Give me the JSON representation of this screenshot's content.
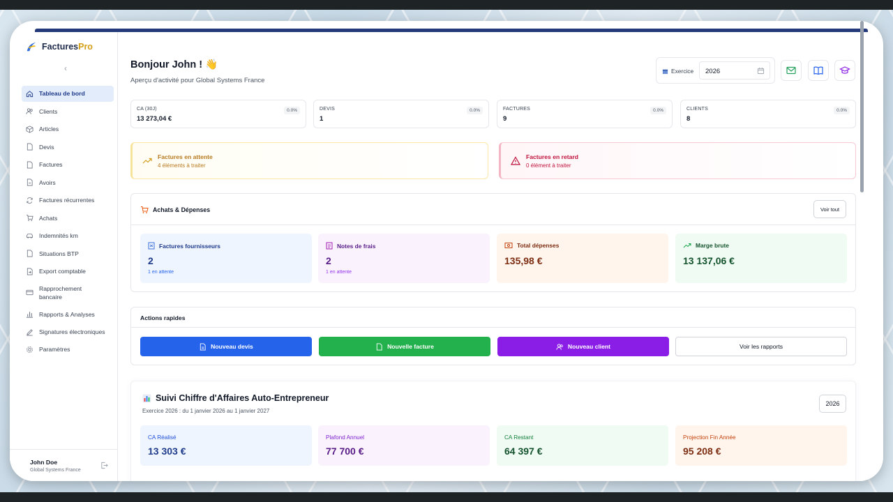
{
  "app": {
    "brand_main": "Factures",
    "brand_accent": "Pro"
  },
  "sidebar": {
    "collapse_icon": "chevron-left-icon",
    "items": [
      {
        "label": "Tableau de bord",
        "icon": "home-icon"
      },
      {
        "label": "Clients",
        "icon": "users-icon"
      },
      {
        "label": "Articles",
        "icon": "box-icon"
      },
      {
        "label": "Devis",
        "icon": "file-icon"
      },
      {
        "label": "Factures",
        "icon": "file-icon"
      },
      {
        "label": "Avoirs",
        "icon": "file-minus-icon"
      },
      {
        "label": "Factures récurrentes",
        "icon": "refresh-icon"
      },
      {
        "label": "Achats",
        "icon": "cart-icon"
      },
      {
        "label": "Indemnités km",
        "icon": "car-icon"
      },
      {
        "label": "Situations BTP",
        "icon": "file-icon"
      },
      {
        "label": "Export comptable",
        "icon": "export-icon"
      },
      {
        "label": "Rapprochement bancaire",
        "icon": "card-icon"
      },
      {
        "label": "Rapports & Analyses",
        "icon": "bar-chart-icon"
      },
      {
        "label": "Signatures électroniques",
        "icon": "pen-icon"
      },
      {
        "label": "Paramètres",
        "icon": "gear-icon"
      }
    ],
    "user": {
      "name": "John Doe",
      "org": "Global Systems France"
    }
  },
  "header": {
    "greeting": "Bonjour John ! 👋",
    "subtitle": "Aperçu d'activité pour Global Systems France",
    "exercise_label": "Exercice",
    "exercise_value": "2026"
  },
  "stats": [
    {
      "label": "CA (30J)",
      "value": "13 273,04 €",
      "badge": "0.0%"
    },
    {
      "label": "DEVIS",
      "value": "1",
      "badge": "0.0%"
    },
    {
      "label": "FACTURES",
      "value": "9",
      "badge": "0.0%"
    },
    {
      "label": "CLIENTS",
      "value": "8",
      "badge": "0.0%"
    }
  ],
  "alerts": {
    "pending": {
      "title": "Factures en attente",
      "sub": "4 éléments à traiter"
    },
    "late": {
      "title": "Factures en retard",
      "sub": "0 élément à traiter"
    }
  },
  "achats": {
    "title": "Achats & Dépenses",
    "see_all": "Voir tout",
    "metrics": [
      {
        "label": "Factures fournisseurs",
        "value": "2",
        "sub": "1 en attente"
      },
      {
        "label": "Notes de frais",
        "value": "2",
        "sub": "1 en attente"
      },
      {
        "label": "Total dépenses",
        "value": "135,98 €",
        "sub": ""
      },
      {
        "label": "Marge brute",
        "value": "13 137,06 €",
        "sub": ""
      }
    ]
  },
  "actions": {
    "title": "Actions rapides",
    "buttons": [
      {
        "label": "Nouveau devis"
      },
      {
        "label": "Nouvelle facture"
      },
      {
        "label": "Nouveau client"
      },
      {
        "label": "Voir les rapports"
      }
    ]
  },
  "ca": {
    "title": "Suivi Chiffre d'Affaires Auto-Entrepreneur",
    "subtitle": "Exercice 2026 : du 1 janvier 2026 au 1 janvier 2027",
    "year": "2026",
    "cards": [
      {
        "label": "CA Réalisé",
        "value": "13 303 €"
      },
      {
        "label": "Plafond Annuel",
        "value": "77 700 €"
      },
      {
        "label": "CA Restant",
        "value": "64 397 €"
      },
      {
        "label": "Projection Fin Année",
        "value": "95 208 €"
      }
    ]
  },
  "colors": {
    "primary_blue": "#2563eb",
    "green": "#22b14c",
    "purple": "#8b1ee6",
    "navy": "#243a7a"
  }
}
